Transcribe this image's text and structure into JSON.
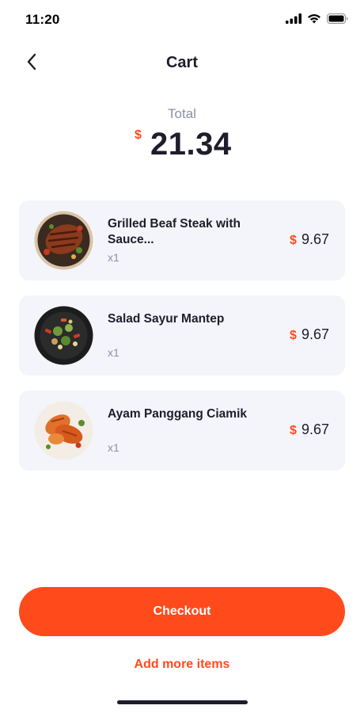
{
  "status_bar": {
    "time": "11:20",
    "icons": [
      "signal-icon",
      "wifi-icon",
      "battery-icon"
    ]
  },
  "nav": {
    "title": "Cart",
    "back_icon": "chevron-left-icon"
  },
  "total": {
    "label": "Total",
    "currency": "$",
    "amount": "21.34"
  },
  "cart_items": [
    {
      "name": "Grilled Beaf Steak with Sauce...",
      "quantity": "x1",
      "currency": "$",
      "price": "9.67",
      "image": "steak-dish"
    },
    {
      "name": "Salad Sayur Mantep",
      "quantity": "x1",
      "currency": "$",
      "price": "9.67",
      "image": "salad-dish"
    },
    {
      "name": "Ayam Panggang Ciamik",
      "quantity": "x1",
      "currency": "$",
      "price": "9.67",
      "image": "chicken-dish"
    }
  ],
  "actions": {
    "checkout_label": "Checkout",
    "add_more_label": "Add more items"
  },
  "colors": {
    "accent": "#ff4a1c",
    "text_primary": "#1d1d2b",
    "text_secondary": "#8a90a6",
    "card_background": "#f4f5fa"
  }
}
